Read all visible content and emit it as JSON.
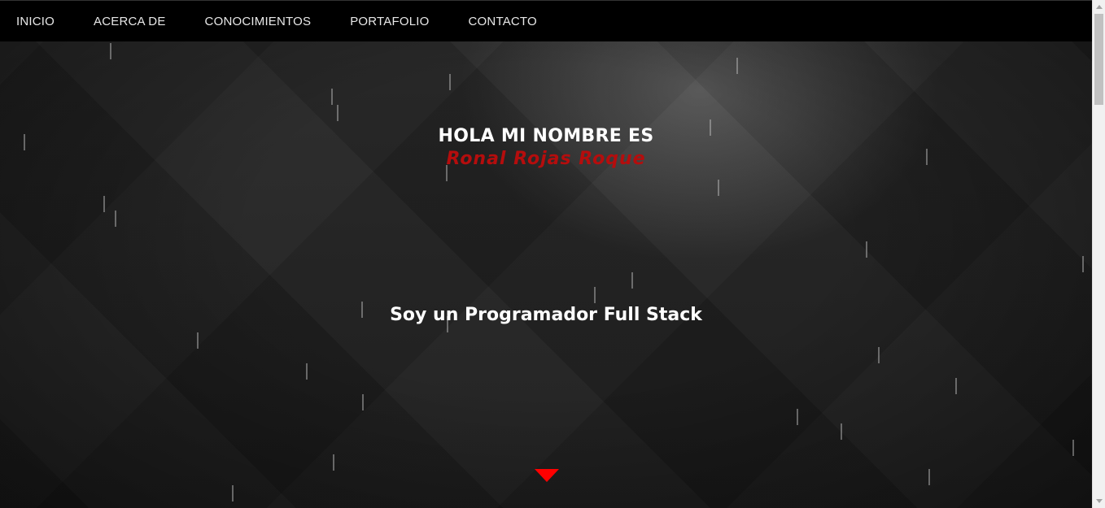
{
  "nav": {
    "items": [
      {
        "label": "INICIO"
      },
      {
        "label": "ACERCA DE"
      },
      {
        "label": "CONOCIMIENTOS"
      },
      {
        "label": "PORTAFOLIO"
      },
      {
        "label": "CONTACTO"
      }
    ]
  },
  "hero": {
    "greeting": "HOLA MI NOMBRE ES",
    "name": "Ronal Rojas Roque",
    "role": "Soy un Programador Full Stack",
    "scroll_icon": "triangle-down-icon"
  },
  "colors": {
    "accent": "#ff0000",
    "name": "#b50d0d",
    "nav_bg": "#000000"
  }
}
